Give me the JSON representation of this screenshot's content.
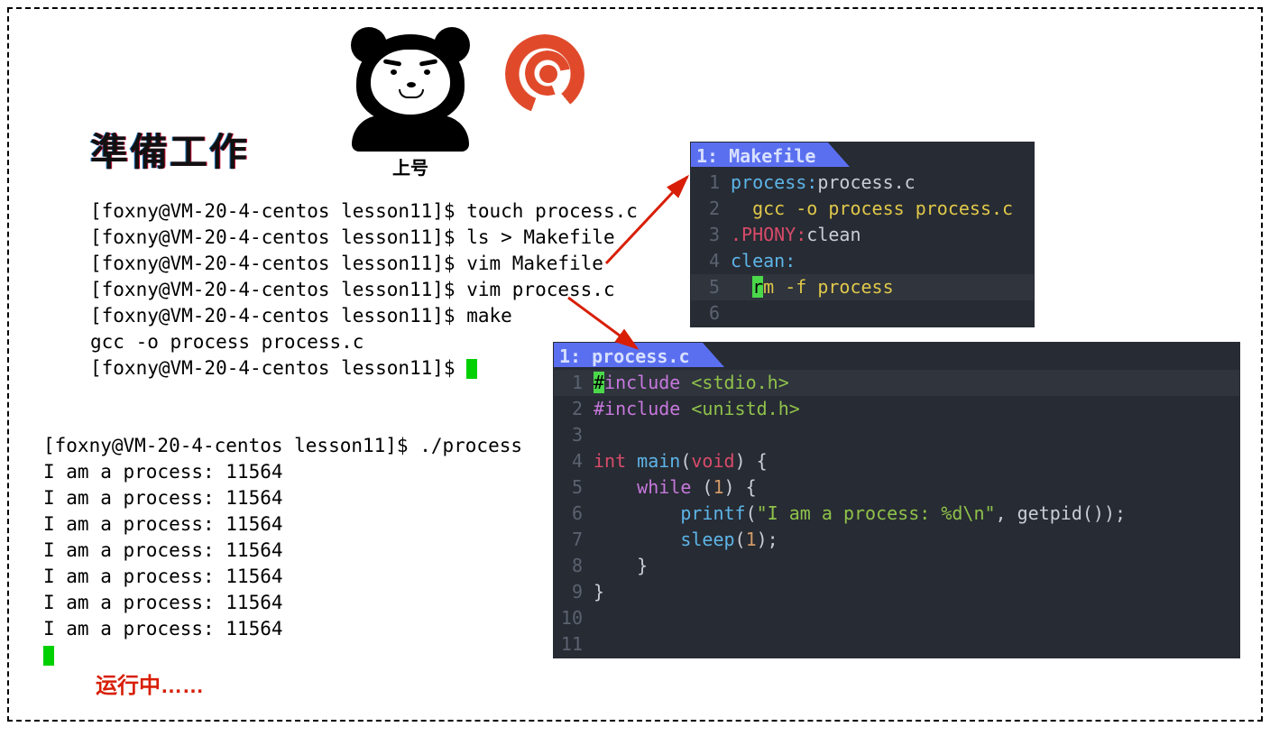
{
  "heading": "準備工作",
  "panda_caption": "上号",
  "running_label": "运行中……",
  "terminal1": {
    "prompt": "[foxny@VM-20-4-centos lesson11]$",
    "lines": [
      "touch process.c",
      "ls > Makefile",
      "vim Makefile",
      "vim process.c",
      "make"
    ],
    "build_output": "gcc -o process process.c"
  },
  "terminal2": {
    "prompt": "[foxny@VM-20-4-centos lesson11]$",
    "command": "./process",
    "output_line": "I am a process: 11564",
    "output_repeat": 7
  },
  "makefile_tab": "1: Makefile",
  "makefile": {
    "1": {
      "target": "process:",
      "deps": "process.c"
    },
    "2": "gcc -o process process.c",
    "3": {
      "phony": ".PHONY:",
      "target": "clean"
    },
    "4": "clean:",
    "5_pre": "r",
    "5_post": "m -f process"
  },
  "process_tab": "1: process.c",
  "source": {
    "l1_a": "#",
    "l1_b": "include",
    "l1_c": " <stdio.h>",
    "l2_a": "#include",
    "l2_b": " <unistd.h>",
    "l4_a": "int",
    "l4_b": " main",
    "l4_c": "(",
    "l4_d": "void",
    "l4_e": ") {",
    "l5_a": "    while",
    "l5_b": " (",
    "l5_c": "1",
    "l5_d": ") {",
    "l6_a": "        printf",
    "l6_b": "(",
    "l6_c": "\"I am a process: %d\\n\"",
    "l6_d": ", getpid());",
    "l7_a": "        sleep",
    "l7_b": "(",
    "l7_c": "1",
    "l7_d": ");",
    "l8": "    }",
    "l9": "}"
  }
}
